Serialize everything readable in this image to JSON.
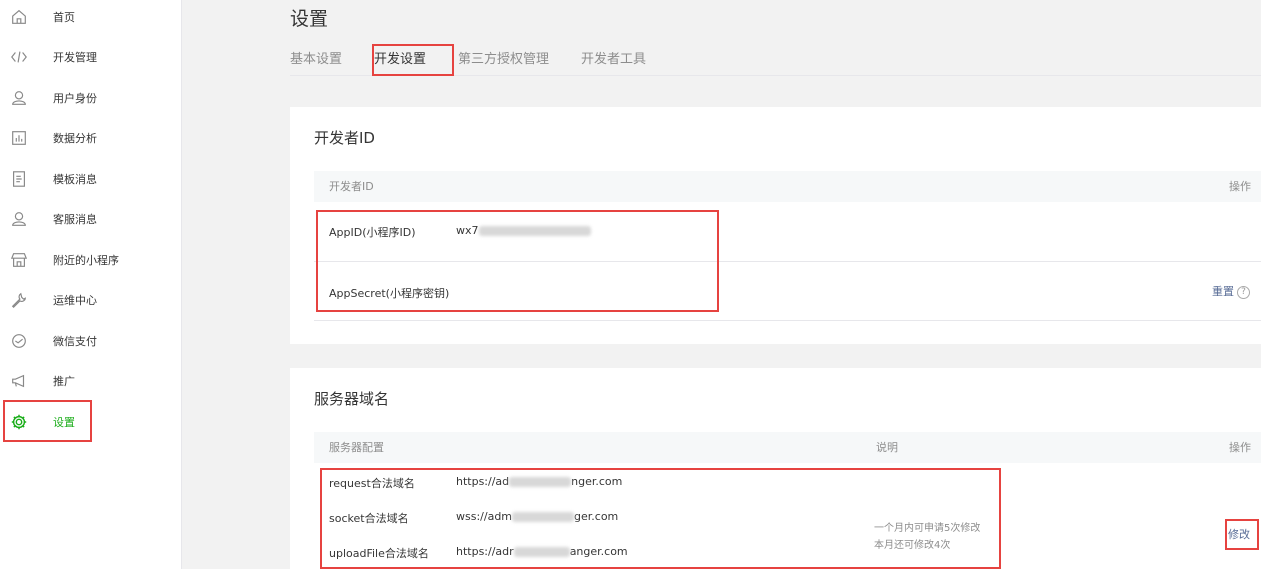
{
  "sidebar": {
    "items": [
      {
        "label": "首页",
        "icon": "home-icon"
      },
      {
        "label": "开发管理",
        "icon": "code-icon"
      },
      {
        "label": "用户身份",
        "icon": "user-icon"
      },
      {
        "label": "数据分析",
        "icon": "chart-icon"
      },
      {
        "label": "模板消息",
        "icon": "template-icon"
      },
      {
        "label": "客服消息",
        "icon": "customer-service-icon"
      },
      {
        "label": "附近的小程序",
        "icon": "store-icon"
      },
      {
        "label": "运维中心",
        "icon": "wrench-icon"
      },
      {
        "label": "微信支付",
        "icon": "payment-icon"
      },
      {
        "label": "推广",
        "icon": "megaphone-icon"
      },
      {
        "label": "设置",
        "icon": "gear-icon",
        "active": true
      }
    ]
  },
  "page": {
    "title": "设置",
    "tabs": [
      "基本设置",
      "开发设置",
      "第三方授权管理",
      "开发者工具"
    ],
    "active_tab": "开发设置"
  },
  "developer_id": {
    "title": "开发者ID",
    "col_id": "开发者ID",
    "col_action": "操作",
    "appid_label": "AppID(小程序ID)",
    "appid_value": "wx7",
    "secret_label": "AppSecret(小程序密钥)",
    "reset_label": "重置",
    "help": "?"
  },
  "server_domain": {
    "title": "服务器域名",
    "col_config": "服务器配置",
    "col_desc": "说明",
    "col_action": "操作",
    "rows": [
      {
        "label": "request合法域名",
        "value_start": "https://ad",
        "value_end": "nger.com"
      },
      {
        "label": "socket合法域名",
        "value_start": "wss://adm",
        "value_end": "ger.com"
      },
      {
        "label": "uploadFile合法域名",
        "value_start": "https://adr",
        "value_end": "anger.com"
      }
    ],
    "desc_line1": "一个月内可申请5次修改",
    "desc_line2": "本月还可修改4次",
    "modify_label": "修改"
  },
  "colors": {
    "accent": "#1aad19",
    "highlight": "#e64340",
    "link": "#576b95"
  }
}
